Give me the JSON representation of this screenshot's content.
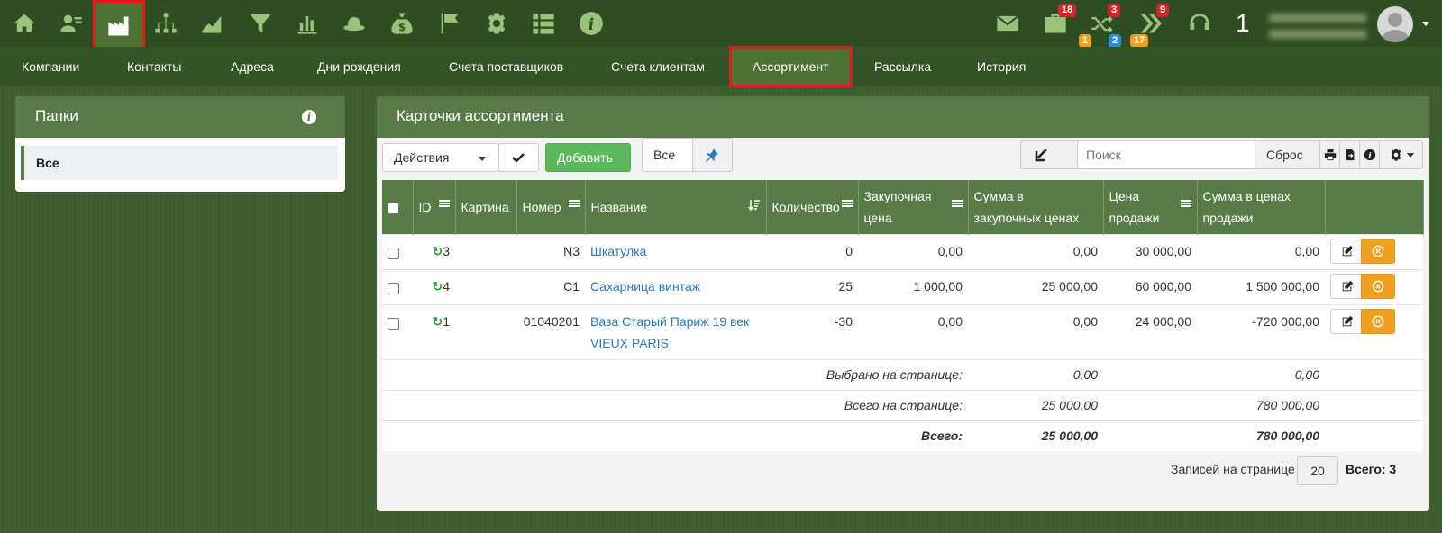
{
  "topbar": {
    "icons": [
      "home-icon",
      "contacts-icon",
      "factory-icon",
      "org-chart-icon",
      "area-chart-icon",
      "funnel-icon",
      "bar-chart-icon",
      "hat-icon",
      "money-bag-icon",
      "flag-icon",
      "gear-icon",
      "list-icon",
      "info-icon"
    ],
    "active_icon": "factory-icon",
    "right_icons": [
      "mail-icon",
      "briefcase-icon",
      "shuffle-icon",
      "double-chevron-icon",
      "headset-icon"
    ],
    "badges": {
      "briefcase_red": "18",
      "briefcase_orange": "1",
      "shuffle_red": "3",
      "shuffle_blue": "2",
      "chevron_red": "9",
      "chevron_orange": "17"
    },
    "count": "1"
  },
  "menu": {
    "items": [
      "Компании",
      "Контакты",
      "Адреса",
      "Дни рождения",
      "Счета поставщиков",
      "Счета клиентам",
      "Ассортимент",
      "Рассылка",
      "История"
    ],
    "active": "Ассортимент"
  },
  "folders": {
    "title": "Папки",
    "items": [
      "Все"
    ]
  },
  "main": {
    "title": "Карточки ассортимента",
    "toolbar": {
      "actions_label": "Действия",
      "add_label": "Добавить",
      "all_label": "Все",
      "search_placeholder": "Поиск",
      "reset_label": "Сброс"
    },
    "columns": {
      "id": "ID",
      "picture": "Картина",
      "number": "Номер",
      "name": "Название",
      "quantity": "Количество",
      "purchase_price_1": "Закупочная",
      "purchase_price_2": "цена",
      "purchase_sum_1": "Сумма в",
      "purchase_sum_2": "закупочных ценах",
      "sale_price_1": "Цена",
      "sale_price_2": "продажи",
      "sale_sum_1": "Сумма в ценах",
      "sale_sum_2": "продажи"
    },
    "rows": [
      {
        "id": "3",
        "number": "N3",
        "name": "Шкатулка",
        "name2": "",
        "quantity": "0",
        "purchase_price": "0,00",
        "purchase_sum": "0,00",
        "sale_price": "30 000,00",
        "sale_sum": "0,00"
      },
      {
        "id": "4",
        "number": "C1",
        "name": "Сахарница винтаж",
        "name2": "",
        "quantity": "25",
        "purchase_price": "1 000,00",
        "purchase_sum": "25 000,00",
        "sale_price": "60 000,00",
        "sale_sum": "1 500 000,00"
      },
      {
        "id": "1",
        "number": "01040201",
        "name": "Ваза Старый Париж 19 век",
        "name2": "VIEUX PARIS",
        "quantity": "-30",
        "purchase_price": "0,00",
        "purchase_sum": "0,00",
        "sale_price": "24 000,00",
        "sale_sum": "-720 000,00"
      }
    ],
    "totals": {
      "selected_label": "Выбрано на странице:",
      "selected_purchase": "0,00",
      "selected_sale": "0,00",
      "page_label": "Всего на странице:",
      "page_purchase": "25 000,00",
      "page_sale": "780 000,00",
      "all_label": "Всего:",
      "all_purchase": "25 000,00",
      "all_sale": "780 000,00"
    },
    "pager": {
      "per_page_label": "Записей на странице",
      "per_page": "20",
      "total": "Всего: 3"
    }
  },
  "colors": {
    "dark_green": "#2f4d23",
    "panel_green": "#587c47",
    "accent_red": "#e01b1b",
    "add_green": "#5cb85c",
    "delete_orange": "#f0a020",
    "link_blue": "#2a7ab8"
  }
}
